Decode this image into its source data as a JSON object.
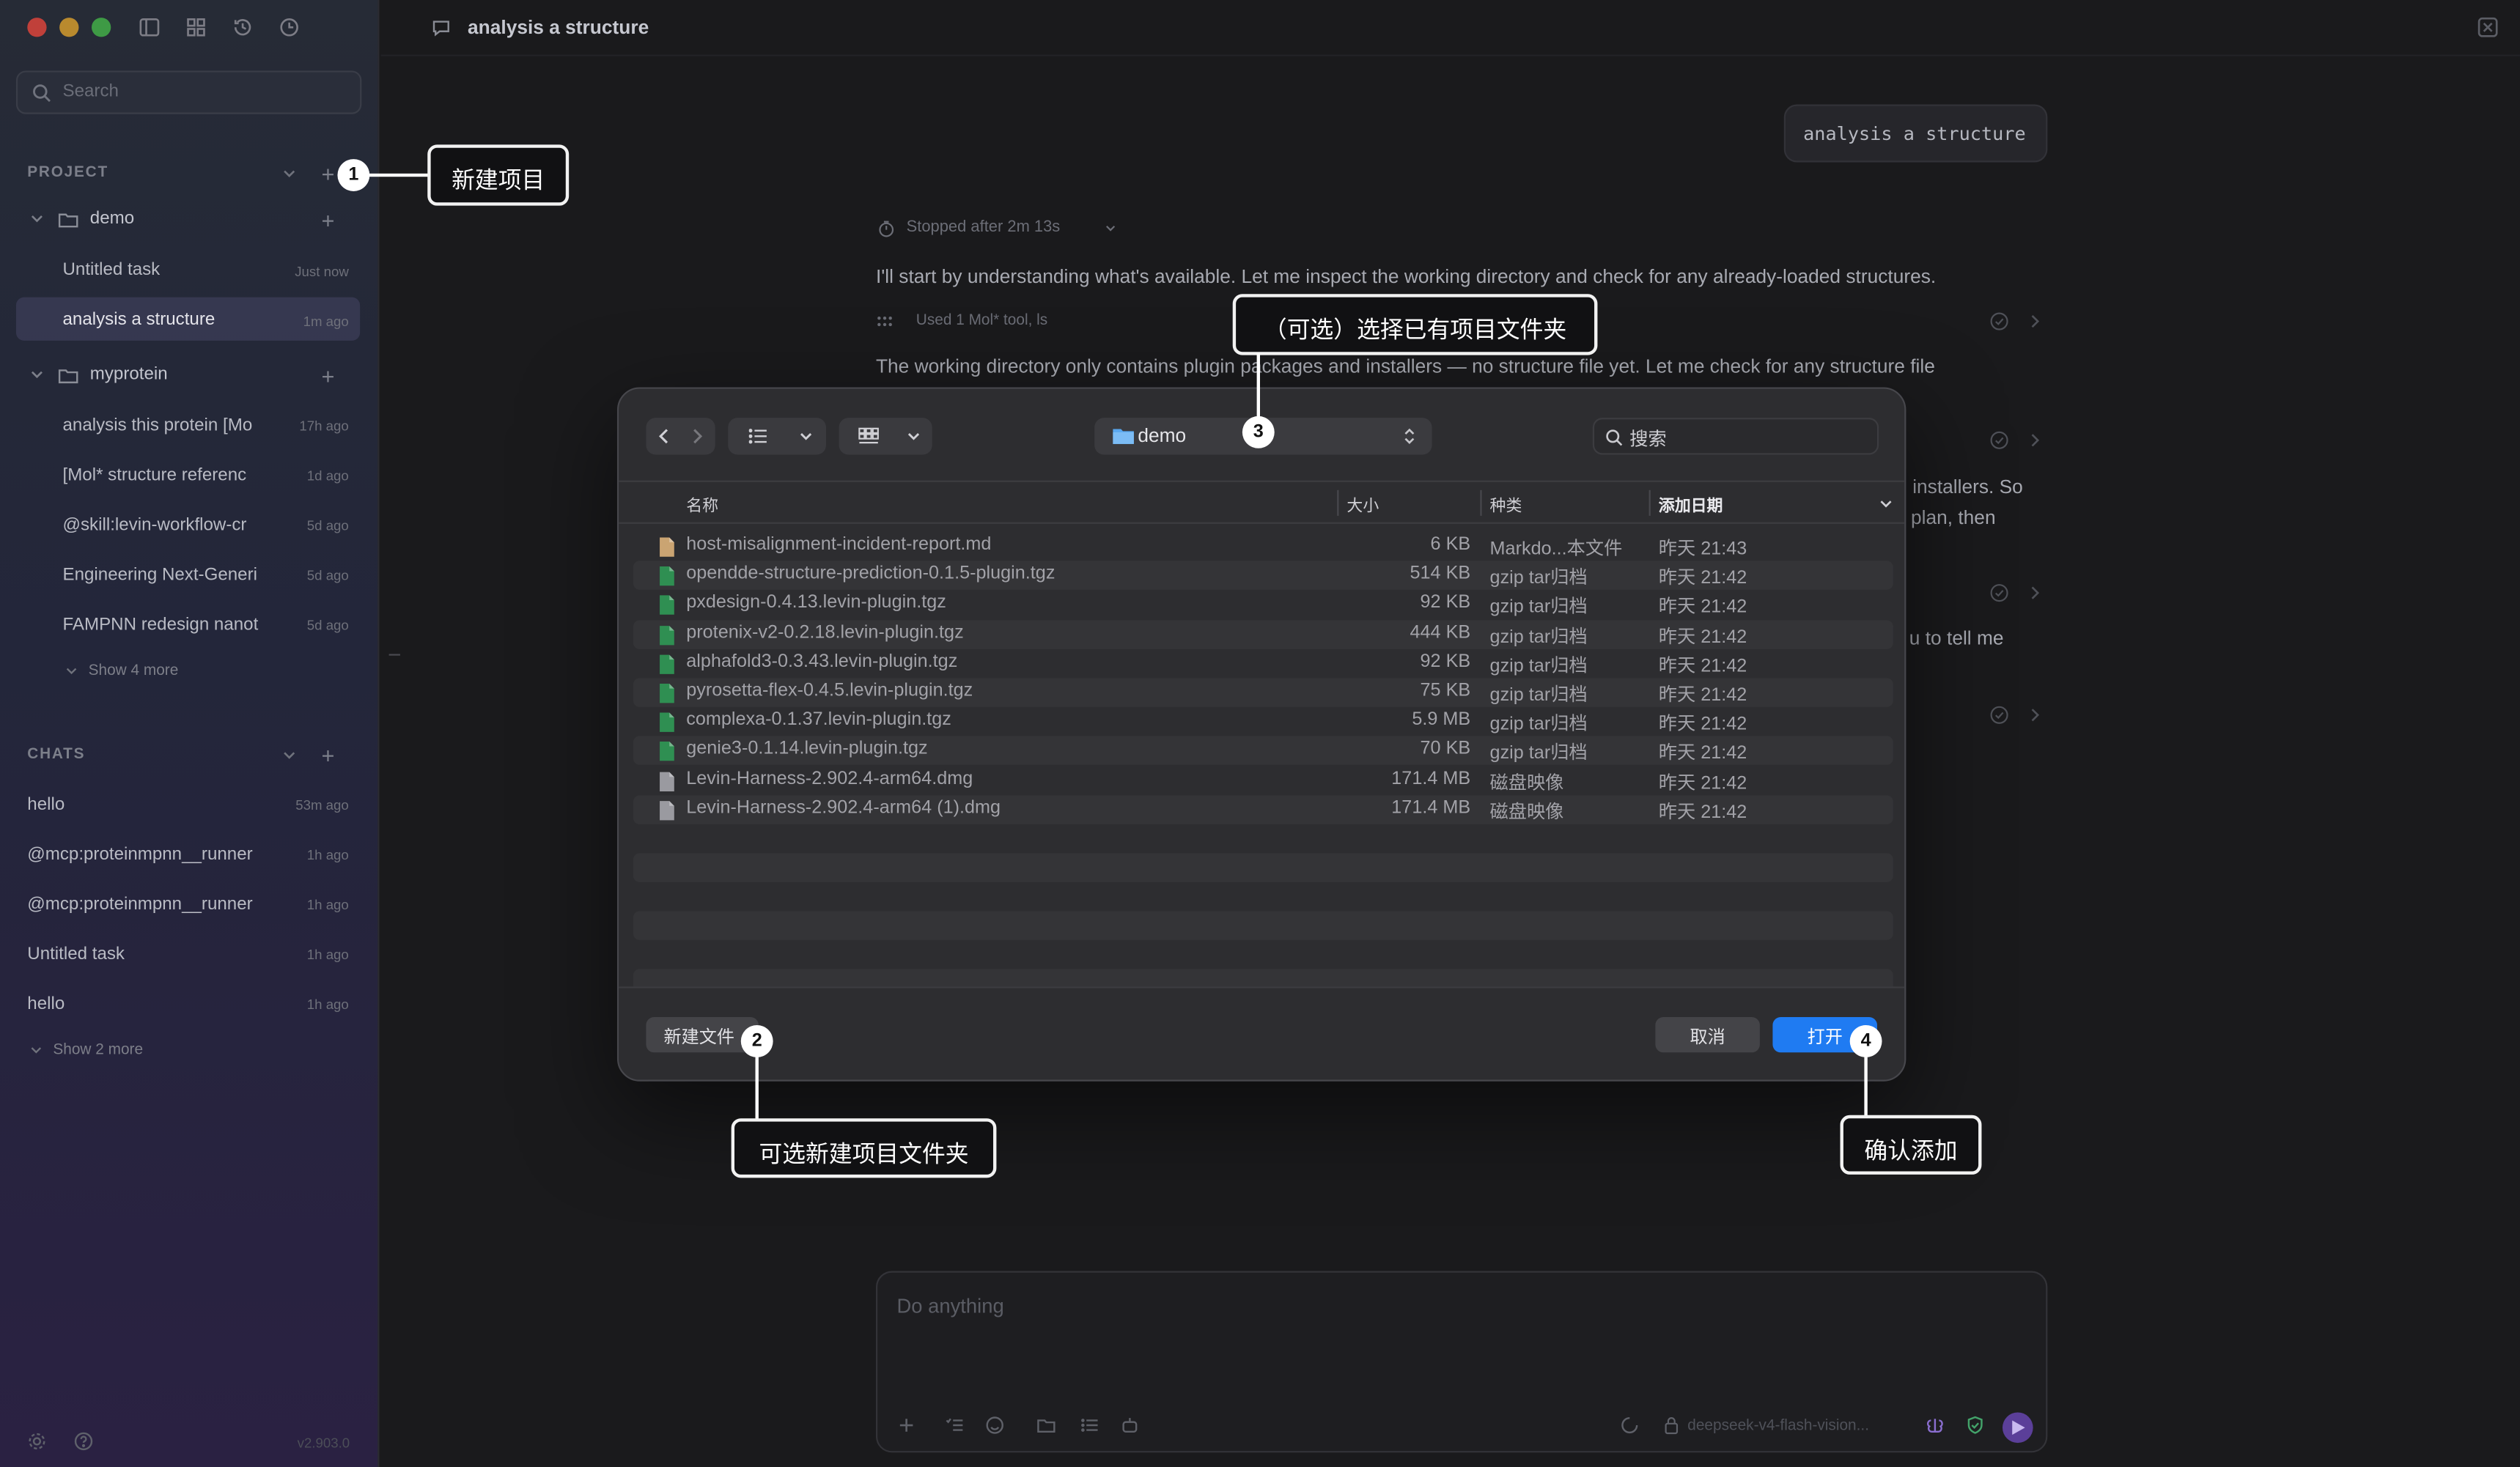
{
  "window": {
    "title": "analysis a structure"
  },
  "sidebar": {
    "search_placeholder": "Search",
    "project_header": "PROJECT",
    "projects": [
      {
        "name": "demo",
        "tasks": [
          {
            "label": "Untitled task",
            "ago": "Just now"
          },
          {
            "label": "analysis a structure",
            "ago": "1m ago",
            "active": true
          }
        ]
      },
      {
        "name": "myprotein",
        "tasks": [
          {
            "label": "analysis this protein [Mo",
            "ago": "17h ago"
          },
          {
            "label": "[Mol* structure referenc",
            "ago": "1d ago"
          },
          {
            "label": "@skill:levin-workflow-cr",
            "ago": "5d ago"
          },
          {
            "label": "Engineering Next-Generi",
            "ago": "5d ago"
          },
          {
            "label": "FAMPNN redesign nanot",
            "ago": "5d ago"
          }
        ]
      }
    ],
    "project_show_more": "Show 4 more",
    "chats_header": "CHATS",
    "chats": [
      {
        "label": "hello",
        "ago": "53m ago"
      },
      {
        "label": "@mcp:proteinmpnn__runner",
        "ago": "1h ago"
      },
      {
        "label": "@mcp:proteinmpnn__runner",
        "ago": "1h ago"
      },
      {
        "label": "Untitled task",
        "ago": "1h ago"
      },
      {
        "label": "hello",
        "ago": "1h ago"
      }
    ],
    "chats_show_more": "Show 2 more",
    "version": "v2.903.0"
  },
  "conversation": {
    "user_message": "analysis a structure",
    "stopped_label": "Stopped after 2m 13s",
    "assistant_line1": "I'll start by understanding what's available. Let me inspect the working directory and check for any already-loaded structures.",
    "tool_used": "Used 1 Mol* tool, ls",
    "assistant_line2": "The working directory only contains plugin packages and installers — no structure file yet. Let me check for any structure file",
    "frag_a": "installers. So",
    "frag_b": "plan, then",
    "frag_c": "u to tell me"
  },
  "composer": {
    "placeholder": "Do anything",
    "model": "deepseek-v4-flash-vision..."
  },
  "dialog": {
    "path": "demo",
    "search_placeholder": "搜索",
    "columns": {
      "name": "名称",
      "size": "大小",
      "kind": "种类",
      "date": "添加日期"
    },
    "files": [
      {
        "name": "host-misalignment-incident-report.md",
        "size": "6 KB",
        "kind": "Markdo...本文件",
        "date": "昨天 21:43",
        "icon": "md"
      },
      {
        "name": "opendde-structure-prediction-0.1.5-plugin.tgz",
        "size": "514 KB",
        "kind": "gzip tar归档",
        "date": "昨天 21:42",
        "icon": "tgz"
      },
      {
        "name": "pxdesign-0.4.13.levin-plugin.tgz",
        "size": "92 KB",
        "kind": "gzip tar归档",
        "date": "昨天 21:42",
        "icon": "tgz"
      },
      {
        "name": "protenix-v2-0.2.18.levin-plugin.tgz",
        "size": "444 KB",
        "kind": "gzip tar归档",
        "date": "昨天 21:42",
        "icon": "tgz"
      },
      {
        "name": "alphafold3-0.3.43.levin-plugin.tgz",
        "size": "92 KB",
        "kind": "gzip tar归档",
        "date": "昨天 21:42",
        "icon": "tgz"
      },
      {
        "name": "pyrosetta-flex-0.4.5.levin-plugin.tgz",
        "size": "75 KB",
        "kind": "gzip tar归档",
        "date": "昨天 21:42",
        "icon": "tgz"
      },
      {
        "name": "complexa-0.1.37.levin-plugin.tgz",
        "size": "5.9 MB",
        "kind": "gzip tar归档",
        "date": "昨天 21:42",
        "icon": "tgz"
      },
      {
        "name": "genie3-0.1.14.levin-plugin.tgz",
        "size": "70 KB",
        "kind": "gzip tar归档",
        "date": "昨天 21:42",
        "icon": "tgz"
      },
      {
        "name": "Levin-Harness-2.902.4-arm64.dmg",
        "size": "171.4 MB",
        "kind": "磁盘映像",
        "date": "昨天 21:42",
        "icon": "dmg"
      },
      {
        "name": "Levin-Harness-2.902.4-arm64 (1).dmg",
        "size": "171.4 MB",
        "kind": "磁盘映像",
        "date": "昨天 21:42",
        "icon": "dmg"
      }
    ],
    "new_folder": "新建文件",
    "cancel": "取消",
    "open": "打开"
  },
  "annotations": [
    {
      "num": "1",
      "text": "新建项目"
    },
    {
      "num": "2",
      "text": "可选新建项目文件夹"
    },
    {
      "num": "3",
      "text": "（可选）选择已有项目文件夹"
    },
    {
      "num": "4",
      "text": "确认添加"
    }
  ],
  "colors": {
    "accent": "#1f7bf2",
    "send": "#5b3f99",
    "sidebar_active": "#3a3552"
  }
}
